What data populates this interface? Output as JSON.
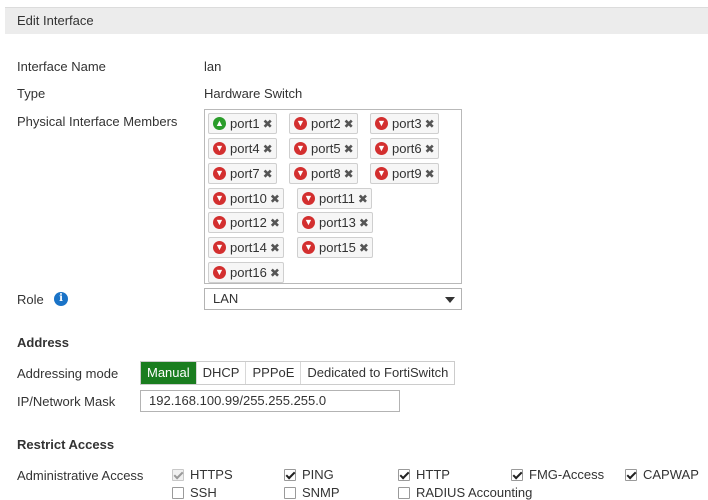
{
  "header": {
    "title": "Edit Interface"
  },
  "fields": {
    "interface_name_label": "Interface Name",
    "interface_name_value": "lan",
    "type_label": "Type",
    "type_value": "Hardware Switch",
    "members_label": "Physical Interface Members",
    "role_label": "Role",
    "role_value": "LAN"
  },
  "members": [
    {
      "name": "port1",
      "status": "up"
    },
    {
      "name": "port2",
      "status": "down"
    },
    {
      "name": "port3",
      "status": "down"
    },
    {
      "name": "port4",
      "status": "down"
    },
    {
      "name": "port5",
      "status": "down"
    },
    {
      "name": "port6",
      "status": "down"
    },
    {
      "name": "port7",
      "status": "down"
    },
    {
      "name": "port8",
      "status": "down"
    },
    {
      "name": "port9",
      "status": "down"
    },
    {
      "name": "port10",
      "status": "down"
    },
    {
      "name": "port11",
      "status": "down"
    },
    {
      "name": "port12",
      "status": "down"
    },
    {
      "name": "port13",
      "status": "down"
    },
    {
      "name": "port14",
      "status": "down"
    },
    {
      "name": "port15",
      "status": "down"
    },
    {
      "name": "port16",
      "status": "down"
    }
  ],
  "address": {
    "section_title": "Address",
    "mode_label": "Addressing mode",
    "modes": [
      "Manual",
      "DHCP",
      "PPPoE",
      "Dedicated to FortiSwitch"
    ],
    "active_mode": "Manual",
    "ip_label": "IP/Network Mask",
    "ip_value": "192.168.100.99/255.255.255.0"
  },
  "restrict": {
    "section_title": "Restrict Access",
    "admin_label": "Administrative Access",
    "options": [
      {
        "label": "HTTPS",
        "checked": true,
        "disabled": true
      },
      {
        "label": "PING",
        "checked": true,
        "disabled": false
      },
      {
        "label": "HTTP",
        "checked": true,
        "disabled": false
      },
      {
        "label": "FMG-Access",
        "checked": true,
        "disabled": false
      },
      {
        "label": "CAPWAP",
        "checked": true,
        "disabled": false
      },
      {
        "label": "SSH",
        "checked": false,
        "disabled": false
      },
      {
        "label": "SNMP",
        "checked": false,
        "disabled": false
      },
      {
        "label": "RADIUS Accounting",
        "checked": false,
        "disabled": false
      }
    ]
  },
  "icons": {
    "info": "info-icon",
    "status_up": "arrow-up-circle-icon",
    "status_down": "arrow-down-circle-icon",
    "remove": "close-icon"
  },
  "colors": {
    "accent_active": "#1a7d1f",
    "status_up": "#2a9d2a",
    "status_down": "#d32f2f",
    "info": "#1a73c7"
  }
}
